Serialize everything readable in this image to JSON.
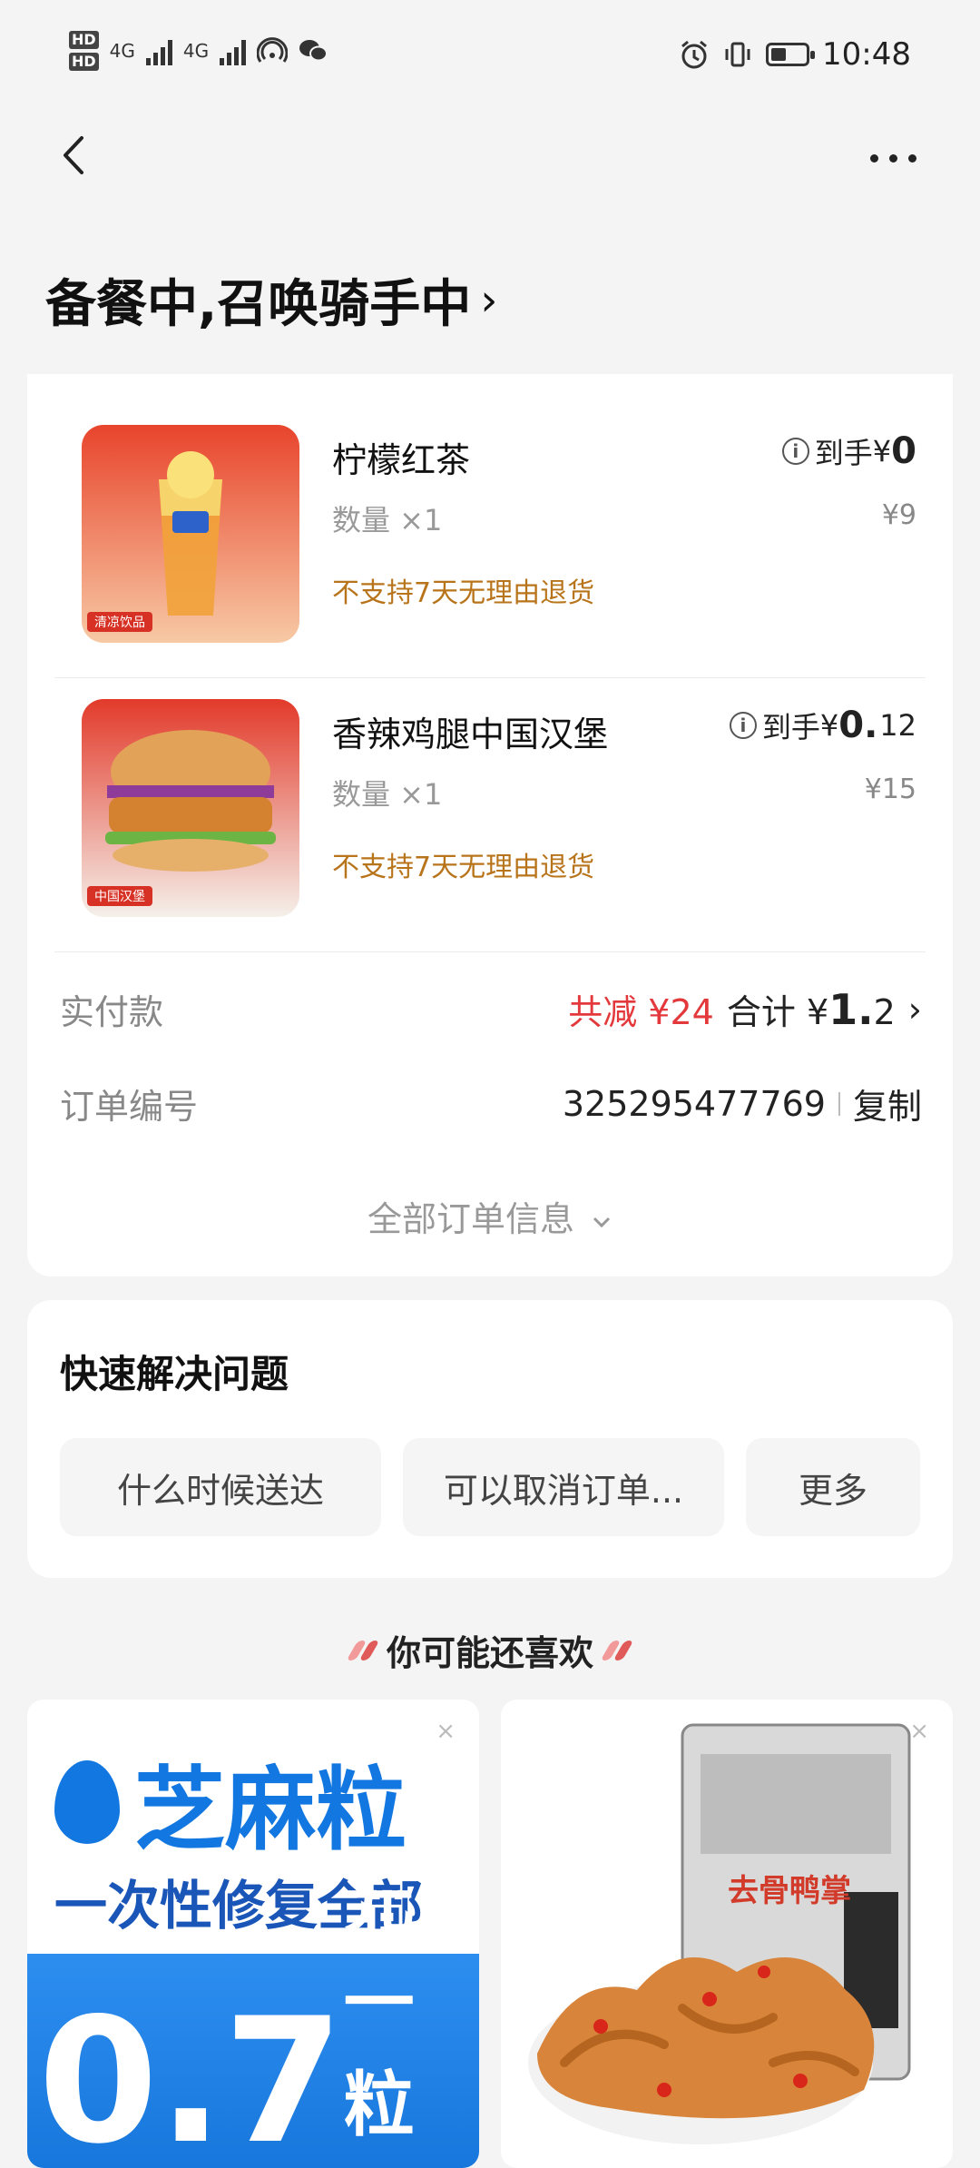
{
  "status_bar": {
    "hd1": "HD",
    "hd2": "HD",
    "net1": "4G",
    "net2": "4G",
    "time": "10:48",
    "battery_level": 0.45
  },
  "header": {
    "title": "备餐中,召唤骑手中",
    "title_chevron": "›"
  },
  "order_items": [
    {
      "name": "柠檬红茶",
      "qty": "数量 ×1",
      "policy": "不支持7天无理由退货",
      "price_prefix": "到手",
      "price_currency": "¥",
      "price_int": "0",
      "price_dec": "",
      "original_price": "¥9",
      "image_tag": "清凉饮品"
    },
    {
      "name": "香辣鸡腿中国汉堡",
      "qty": "数量 ×1",
      "policy": "不支持7天无理由退货",
      "price_prefix": "到手",
      "price_currency": "¥",
      "price_int": "0.",
      "price_dec": "12",
      "original_price": "¥15",
      "image_tag": "中国汉堡"
    }
  ],
  "payment": {
    "label": "实付款",
    "discount": "共减 ¥24",
    "total_label": "合计",
    "total_currency": "¥",
    "total_int": "1.",
    "total_dec": "2",
    "chevron": "›"
  },
  "order_no": {
    "label": "订单编号",
    "value": "325295477769",
    "copy": "复制"
  },
  "expand": {
    "label": "全部订单信息",
    "icon": "chevron-down-icon"
  },
  "quick": {
    "title": "快速解决问题",
    "chips": [
      "什么时候送达",
      "可以取消订单...",
      "更多"
    ]
  },
  "recommend": {
    "title": "你可能还喜欢"
  },
  "ads": [
    {
      "brand": "芝麻粒",
      "slogan": "一次性修复全部",
      "promo_big": "0.7",
      "promo_small": "元一粒",
      "close": "×"
    },
    {
      "product_label": "去骨鸭掌",
      "close": "×"
    }
  ],
  "colors": {
    "accent_red": "#e4393c",
    "policy_brown": "#b8741a",
    "brand_blue": "#1277e1"
  }
}
